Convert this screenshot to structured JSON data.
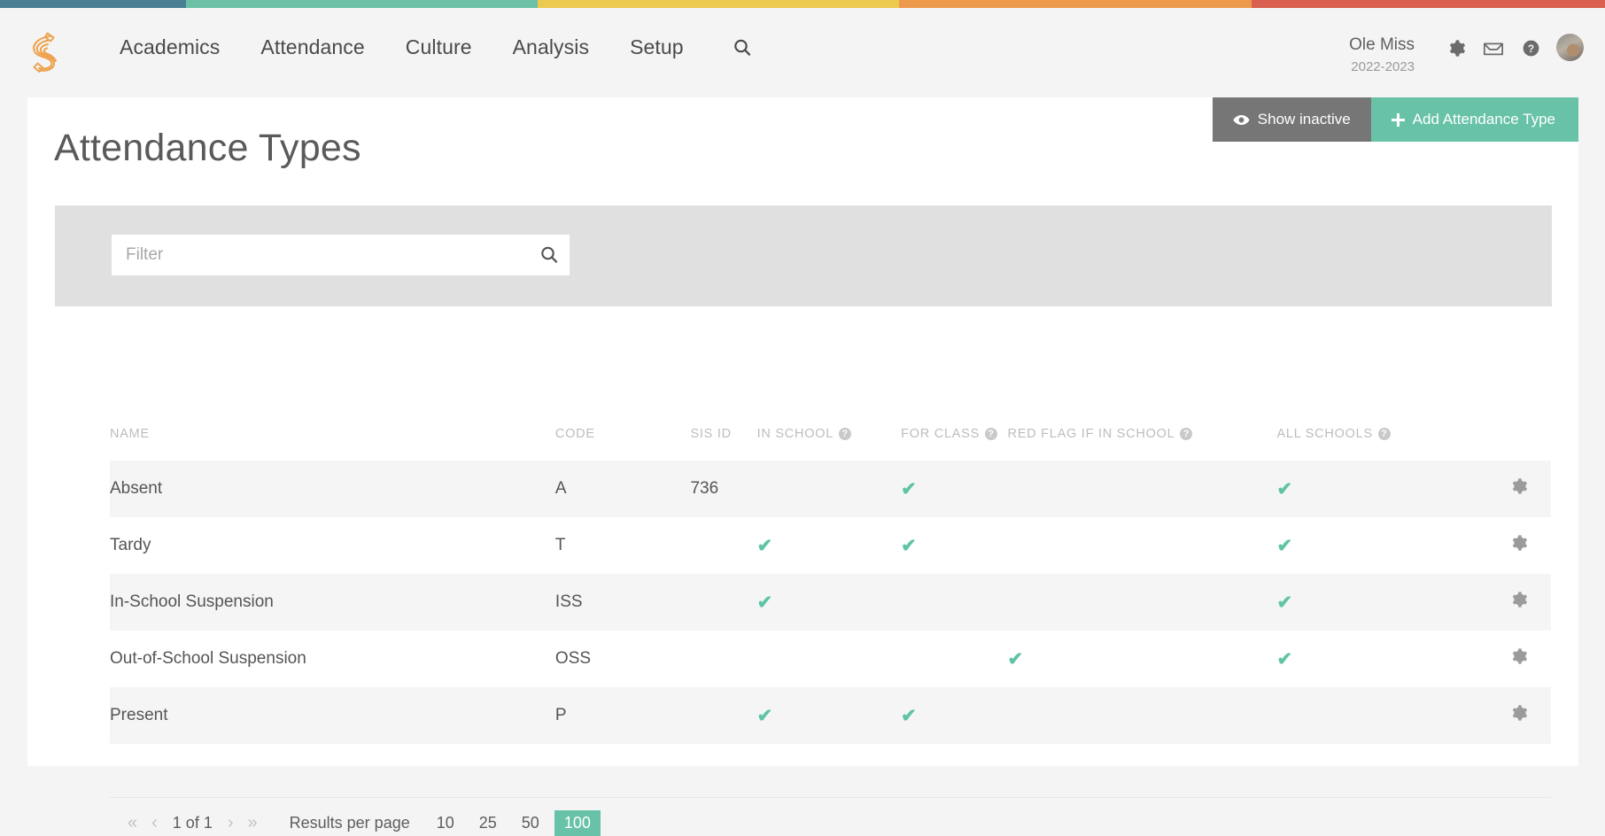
{
  "topbar_colors": [
    "#4a7f93",
    "#6cc0a6",
    "#ecc94f",
    "#ed9a4c",
    "#d9604f"
  ],
  "nav": {
    "logo_icon": "kickboard-pencil-logo",
    "links": [
      "Academics",
      "Attendance",
      "Culture",
      "Analysis",
      "Setup"
    ],
    "search_icon": "search-icon",
    "school_name": "Ole Miss",
    "school_year": "2022-2023",
    "icons": [
      "gear-icon",
      "inbox-icon",
      "help-circle-icon"
    ],
    "avatar": "user-avatar"
  },
  "actions": {
    "show_inactive_label": "Show inactive",
    "show_inactive_icon": "eye-icon",
    "show_inactive_color": "#767676",
    "add_type_label": "Add Attendance Type",
    "add_type_icon": "plus-icon",
    "add_type_color": "#68c2a8"
  },
  "page": {
    "title": "Attendance Types"
  },
  "filter": {
    "placeholder": "Filter",
    "value": "",
    "icon": "search-icon"
  },
  "table": {
    "columns": [
      {
        "label": "NAME",
        "help": false
      },
      {
        "label": "CODE",
        "help": false
      },
      {
        "label": "SIS ID",
        "help": false
      },
      {
        "label": "IN SCHOOL",
        "help": true
      },
      {
        "label": "FOR CLASS",
        "help": true
      },
      {
        "label": "RED FLAG IF IN SCHOOL",
        "help": true
      },
      {
        "label": "ALL SCHOOLS",
        "help": true
      },
      {
        "label": "",
        "help": false
      }
    ],
    "check_glyph": "✔",
    "check_color": "#5ec4a5",
    "row_action_icon": "gear-icon",
    "rows": [
      {
        "name": "Absent",
        "code": "A",
        "sis_id": "736",
        "in_school": false,
        "for_class": true,
        "red_flag": false,
        "all_schools": true
      },
      {
        "name": "Tardy",
        "code": "T",
        "sis_id": "",
        "in_school": true,
        "for_class": true,
        "red_flag": false,
        "all_schools": true
      },
      {
        "name": "In-School Suspension",
        "code": "ISS",
        "sis_id": "",
        "in_school": true,
        "for_class": false,
        "red_flag": false,
        "all_schools": true
      },
      {
        "name": "Out-of-School Suspension",
        "code": "OSS",
        "sis_id": "",
        "in_school": false,
        "for_class": false,
        "red_flag": true,
        "all_schools": true
      },
      {
        "name": "Present",
        "code": "P",
        "sis_id": "",
        "in_school": true,
        "for_class": true,
        "red_flag": false,
        "all_schools": false
      }
    ]
  },
  "pagination": {
    "first_glyph": "«",
    "prev_glyph": "‹",
    "page_text": "1 of 1",
    "next_glyph": "›",
    "last_glyph": "»",
    "results_label": "Results per page",
    "sizes": [
      "10",
      "25",
      "50",
      "100"
    ],
    "active_size": "100",
    "active_color": "#68c2a8"
  }
}
